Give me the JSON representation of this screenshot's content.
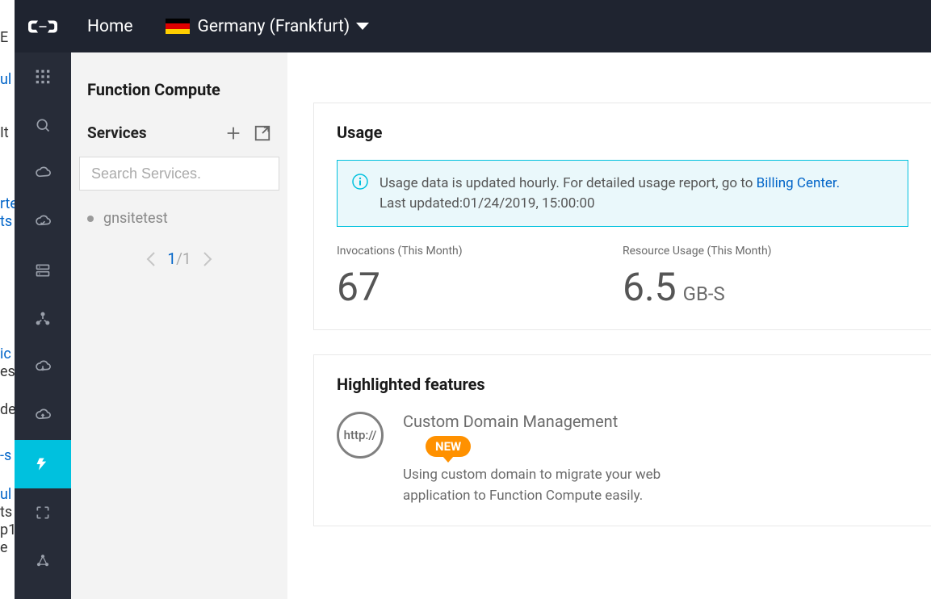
{
  "topbar": {
    "home": "Home",
    "region": "Germany (Frankfurt)"
  },
  "ghosts": {
    "E": "E",
    "ul": "ul",
    "It": "It",
    "rte": "rte",
    "ts": "ts",
    "ic": "ic",
    "es": "es",
    "de": "de",
    "sul": "-s",
    "ul2": "ul",
    "ts2": "ts",
    "p1": "p1",
    "e2": "e"
  },
  "panel": {
    "title": "Function Compute",
    "subtitle": "Services",
    "search_placeholder": "Search Services.",
    "services": [
      "gnsitetest"
    ],
    "pager": {
      "current": "1",
      "total": "/1"
    }
  },
  "usage": {
    "title": "Usage",
    "notice_pre": "Usage data is updated hourly. For detailed usage report, go to  ",
    "notice_link": "Billing Center.",
    "notice_updated": "Last updated:01/24/2019, 15:00:00",
    "metrics": {
      "invocations": {
        "label": "Invocations (This Month)",
        "value": "67"
      },
      "resource": {
        "label": "Resource Usage (This Month)",
        "value": "6.5",
        "unit": "GB-S"
      }
    }
  },
  "features": {
    "title": "Highlighted features",
    "icon_text": "http://",
    "name": "Custom Domain Management",
    "badge": "NEW",
    "desc": "Using custom domain to migrate your web application to Function Compute easily."
  }
}
